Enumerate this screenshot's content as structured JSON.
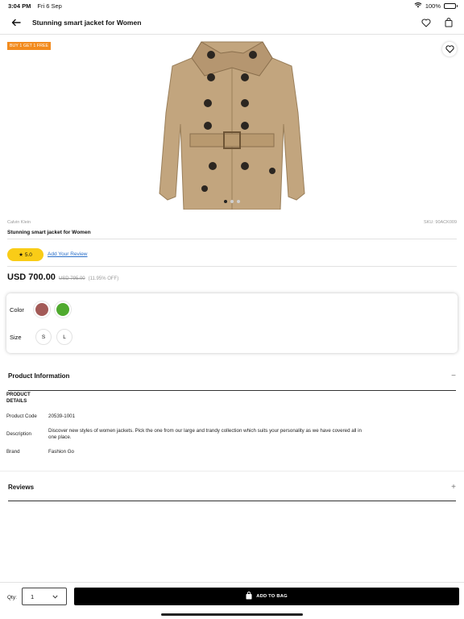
{
  "status_bar": {
    "time": "3:04 PM",
    "date": "Fri 6 Sep",
    "battery": "100%"
  },
  "header": {
    "title": "Stunning smart jacket for Women",
    "back_icon": "arrow-left-icon",
    "wishlist_icon": "heart-icon",
    "bag_icon": "shopping-bag-icon"
  },
  "gallery": {
    "promo_badge": "BUY 1 GET 1 FREE",
    "image_count": 3,
    "active_index": 0
  },
  "product": {
    "brand": "Calvin Klein",
    "sku": "SKU: 90ACK009",
    "name": "Stunning smart jacket for Women",
    "rating": "5.0",
    "add_review": "Add Your Review",
    "price": "USD 700.00",
    "old_price": "USD 795.00",
    "discount": "(11.95% OFF)"
  },
  "options": {
    "color_label": "Color",
    "colors": [
      "#a35a57",
      "#4faa2e"
    ],
    "size_label": "Size",
    "sizes": [
      "S",
      "L"
    ]
  },
  "product_information": {
    "heading": "Product Information",
    "toggle": "−",
    "details_title": "PRODUCT DETAILS",
    "rows": [
      {
        "key": "Product Code",
        "value": "20539-1001"
      },
      {
        "key": "Description",
        "value": "Discover new styles of women jackets. Pick the one from our large and trandy collection which suits your personality as we have covered all in one place."
      },
      {
        "key": "Brand",
        "value": "Fashion Go"
      }
    ]
  },
  "reviews": {
    "heading": "Reviews",
    "toggle": "+"
  },
  "bottom_bar": {
    "qty_label": "Qty:",
    "qty_value": "1",
    "add_to_bag": "ADD TO BAG"
  },
  "colors": {
    "accent": "#000000",
    "promo": "#f28b1e",
    "rating": "#f9cc17",
    "link": "#2a6fc9"
  }
}
